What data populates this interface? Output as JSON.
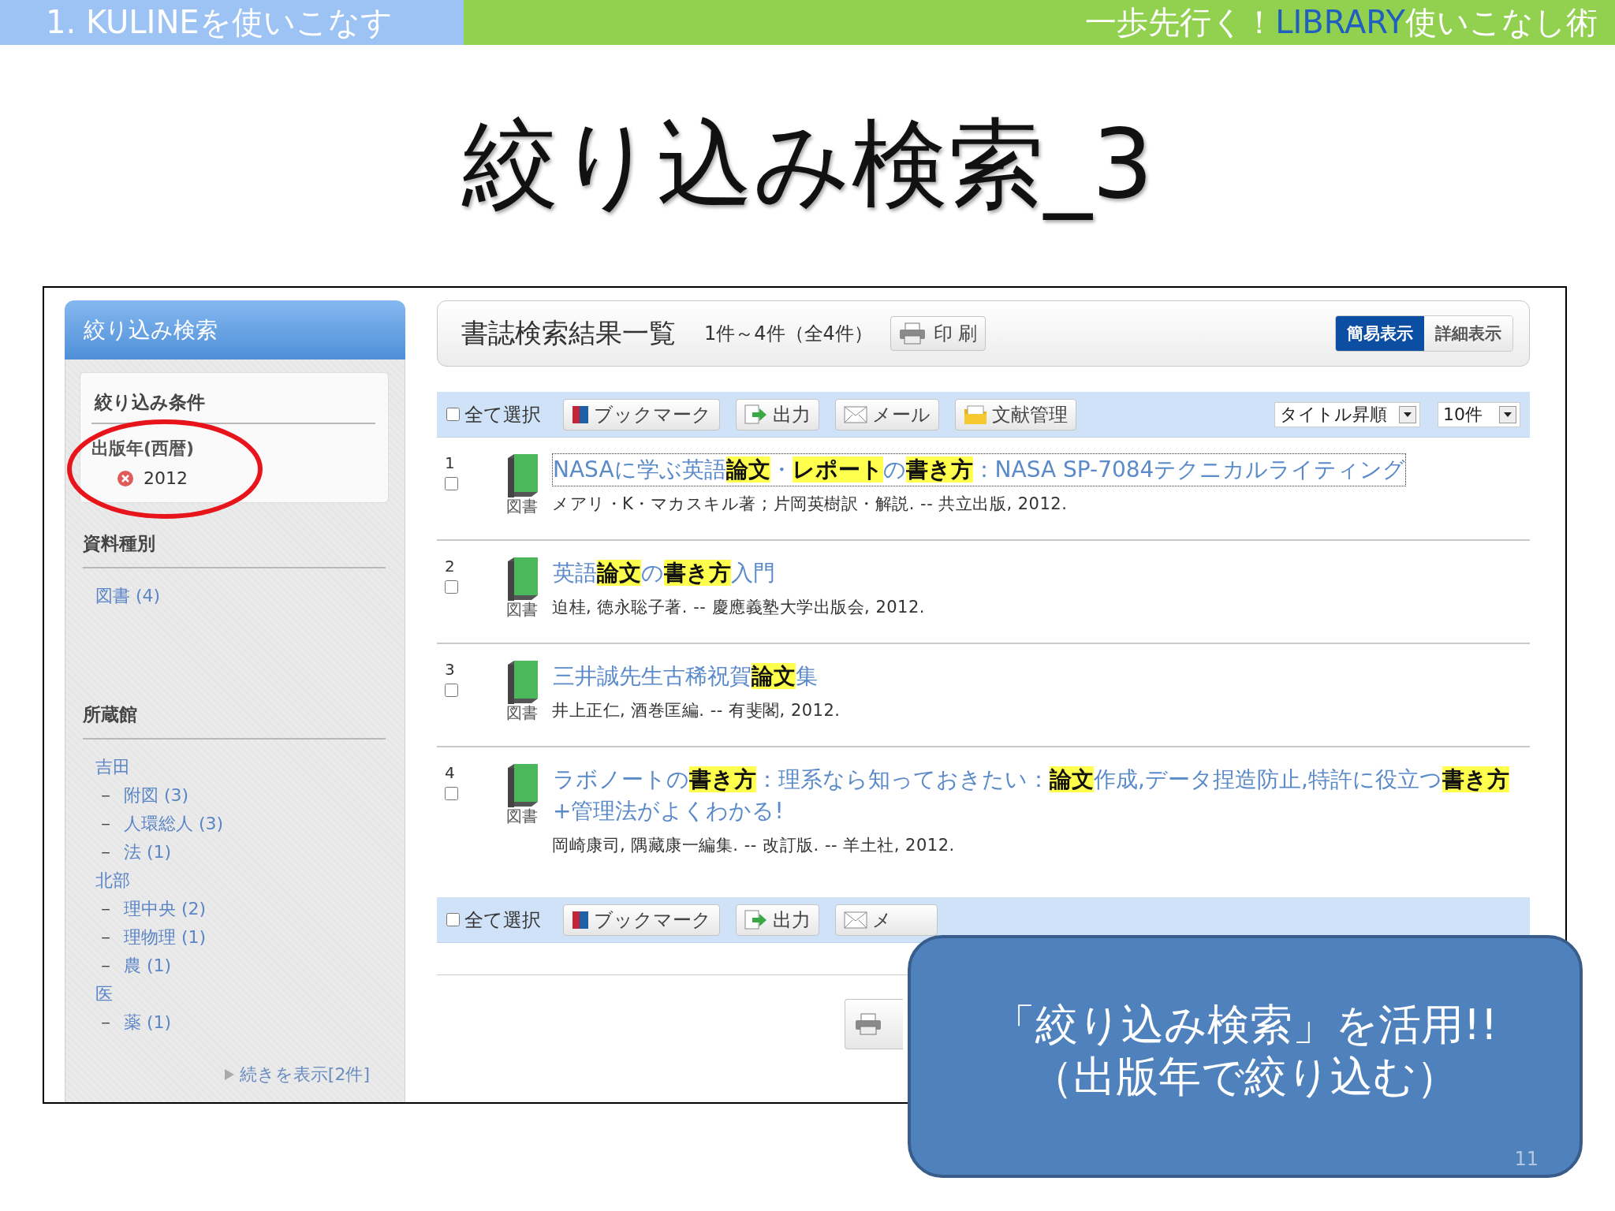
{
  "header": {
    "section": "1. KULINEを使いこなす",
    "tagline": [
      {
        "text": "一歩先行く！",
        "accent": false
      },
      {
        "text": "LIBRARY",
        "accent": true
      },
      {
        "text": "使いこなし術",
        "accent": false
      }
    ]
  },
  "title": "絞り込み検索_3",
  "sidebar": {
    "title": "絞り込み検索",
    "conditions": {
      "heading": "絞り込み条件",
      "filters": [
        {
          "label": "出版年(西暦)",
          "value": "2012"
        }
      ]
    },
    "facets": [
      {
        "heading": "資料種別",
        "items": [
          {
            "label": "図書 (4)"
          }
        ]
      },
      {
        "heading": "所蔵館",
        "items": [
          {
            "label": "吉田",
            "children": [
              {
                "marker": "－",
                "label": "附図 (3)"
              },
              {
                "marker": "－",
                "label": "人環総人 (3)"
              },
              {
                "marker": "－",
                "label": "法 (1)"
              }
            ]
          },
          {
            "label": "北部",
            "children": [
              {
                "marker": "－",
                "label": "理中央 (2)"
              },
              {
                "marker": "－",
                "label": "理物理 (1)"
              },
              {
                "marker": "－",
                "label": "農 (1)"
              }
            ]
          },
          {
            "label": "医",
            "children": [
              {
                "marker": "－",
                "label": "薬 (1)"
              }
            ]
          }
        ],
        "more": "続きを表示[2件]"
      }
    ]
  },
  "results": {
    "heading": "書誌検索結果一覧",
    "range": "1件～4件（全4件）",
    "print_label": "印 刷",
    "views": [
      {
        "label": "簡易表示",
        "selected": true
      },
      {
        "label": "詳細表示",
        "selected": false
      }
    ],
    "toolbar": {
      "select_all": {
        "label": "全て選択",
        "checked": false
      },
      "buttons": [
        {
          "kind": "bookmark",
          "label": "ブックマーク"
        },
        {
          "kind": "export",
          "label": "出力"
        },
        {
          "kind": "mail",
          "label": "メール"
        },
        {
          "kind": "folder",
          "label": "文献管理"
        }
      ],
      "sort": "タイトル昇順",
      "per_page": "10件"
    },
    "items": [
      {
        "number": "1",
        "checked": false,
        "type": "図書",
        "focused": true,
        "title": "NASAに学ぶ英語**論文**・**レポート**の**書き方**：NASA SP-7084テクニカルライティング",
        "details": "メアリ・K・マカスキル著 ; 片岡英樹訳・解説. -- 共立出版, 2012."
      },
      {
        "number": "2",
        "checked": false,
        "type": "図書",
        "focused": false,
        "title": "英語**論文**の**書き方**入門",
        "details": "迫桂, 徳永聡子著. -- 慶應義塾大学出版会, 2012."
      },
      {
        "number": "3",
        "checked": false,
        "type": "図書",
        "focused": false,
        "title": "三井誠先生古稀祝賀**論文**集",
        "details": "井上正仁, 酒巻匡編. -- 有斐閣, 2012."
      },
      {
        "number": "4",
        "checked": false,
        "type": "図書",
        "focused": false,
        "title": "ラボノートの**書き方**：理系なら知っておきたい：**論文**作成,データ捏造防止,特許に役立つ**書き方**+管理法がよくわかる!",
        "details": "岡崎康司, 隅藏康一編集. -- 改訂版. -- 羊土社, 2012."
      }
    ],
    "bottom_toolbar": {
      "select_all": {
        "label": "全て選択",
        "checked": false
      },
      "buttons": [
        {
          "kind": "bookmark",
          "label": "ブックマーク"
        },
        {
          "kind": "export",
          "label": "出力"
        },
        {
          "kind": "mail",
          "label": "メ"
        }
      ]
    }
  },
  "callout": {
    "lines": [
      "「絞り込み検索」を活用!!",
      "（出版年で絞り込む）"
    ],
    "page_number": "11"
  }
}
